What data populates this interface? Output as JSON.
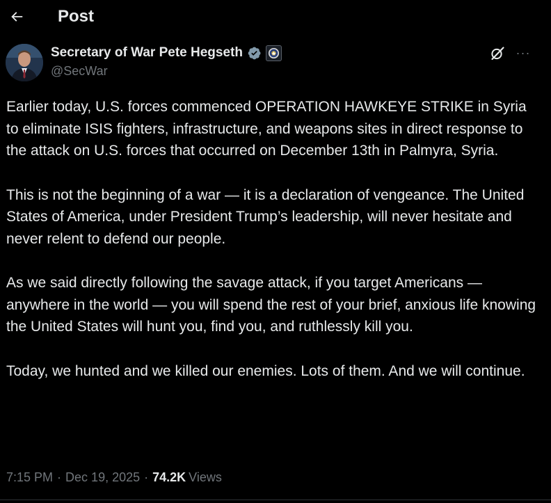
{
  "header": {
    "back_icon": "arrow-left-icon",
    "title": "Post"
  },
  "author": {
    "name": "Secretary of War Pete Hegseth",
    "handle": "@SecWar",
    "verified_badge_color": "#829aab",
    "affiliate_badge": "department-seal-icon"
  },
  "actions": {
    "grok_icon": "grok-icon",
    "more_icon": "more-horizontal-icon",
    "more_label": "···"
  },
  "post": {
    "paragraphs": [
      "Earlier today, U.S. forces commenced OPERATION HAWKEYE STRIKE in Syria to eliminate ISIS fighters, infrastructure, and weapons sites in direct response to the attack on U.S. forces that occurred on December 13th in Palmyra, Syria.",
      "This is not the beginning of a war — it is a declaration of vengeance. The United States of America, under President Trump’s leadership, will never hesitate and never relent to defend our people.",
      "As we said directly following the savage attack, if you target Americans — anywhere in the world — you will spend the rest of your brief, anxious life knowing the United States will hunt you, find you, and ruthlessly kill you.",
      "Today, we hunted and we killed our enemies. Lots of them. And we will continue."
    ]
  },
  "meta": {
    "time": "7:15 PM",
    "separator": "·",
    "date": "Dec 19, 2025",
    "views_count": "74.2K",
    "views_label": "Views"
  },
  "colors": {
    "background": "#000000",
    "text_primary": "#e7e9ea",
    "text_secondary": "#71767b",
    "divider": "#2f3336"
  }
}
